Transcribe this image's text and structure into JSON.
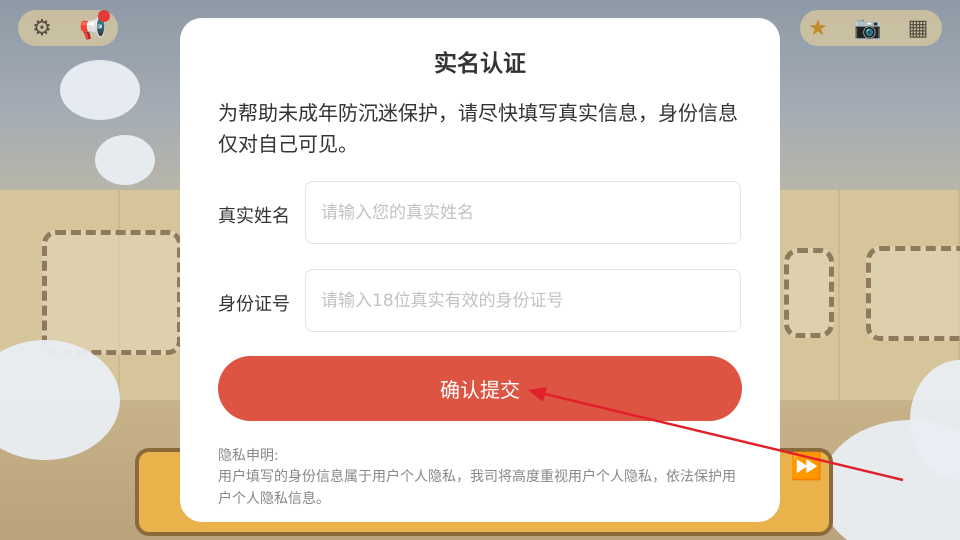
{
  "hud": {
    "icons": [
      "gear-icon",
      "megaphone-icon",
      "star-trophy-icon",
      "camera-icon",
      "menu-grid-icon"
    ]
  },
  "dialog": {
    "title": "实名认证",
    "description": "为帮助未成年防沉迷保护，请尽快填写真实信息，身份信息仅对自己可见。",
    "name_label": "真实姓名",
    "name_placeholder": "请输入您的真实姓名",
    "name_value": "",
    "id_label": "身份证号",
    "id_placeholder": "请输入18位真实有效的身份证号",
    "id_value": "",
    "submit_label": "确认提交",
    "privacy_title": "隐私申明:",
    "privacy_body": "用户填写的身份信息属于用户个人隐私，我司将高度重视用户个人隐私，依法保护用户个人隐私信息。"
  },
  "colors": {
    "accent": "#de5442",
    "annotation_arrow": "#e0202a"
  }
}
